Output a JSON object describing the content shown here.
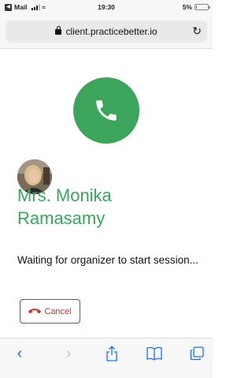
{
  "status_bar": {
    "back_app": "Mail",
    "time": "19:30",
    "battery": "5%"
  },
  "browser": {
    "url": "client.practicebetter.io"
  },
  "session": {
    "host_name": "Mrs. Monika Ramasamy",
    "status_text": "Waiting for organizer to start session...",
    "cancel_label": "Cancel"
  },
  "colors": {
    "accent_green": "#3ba55c",
    "cancel_red": "#c0392b",
    "ios_blue": "#1a73e8"
  },
  "icons": {
    "call": "phone-icon",
    "cancel": "hangup-icon",
    "lock": "lock-icon",
    "reload": "reload-icon"
  }
}
